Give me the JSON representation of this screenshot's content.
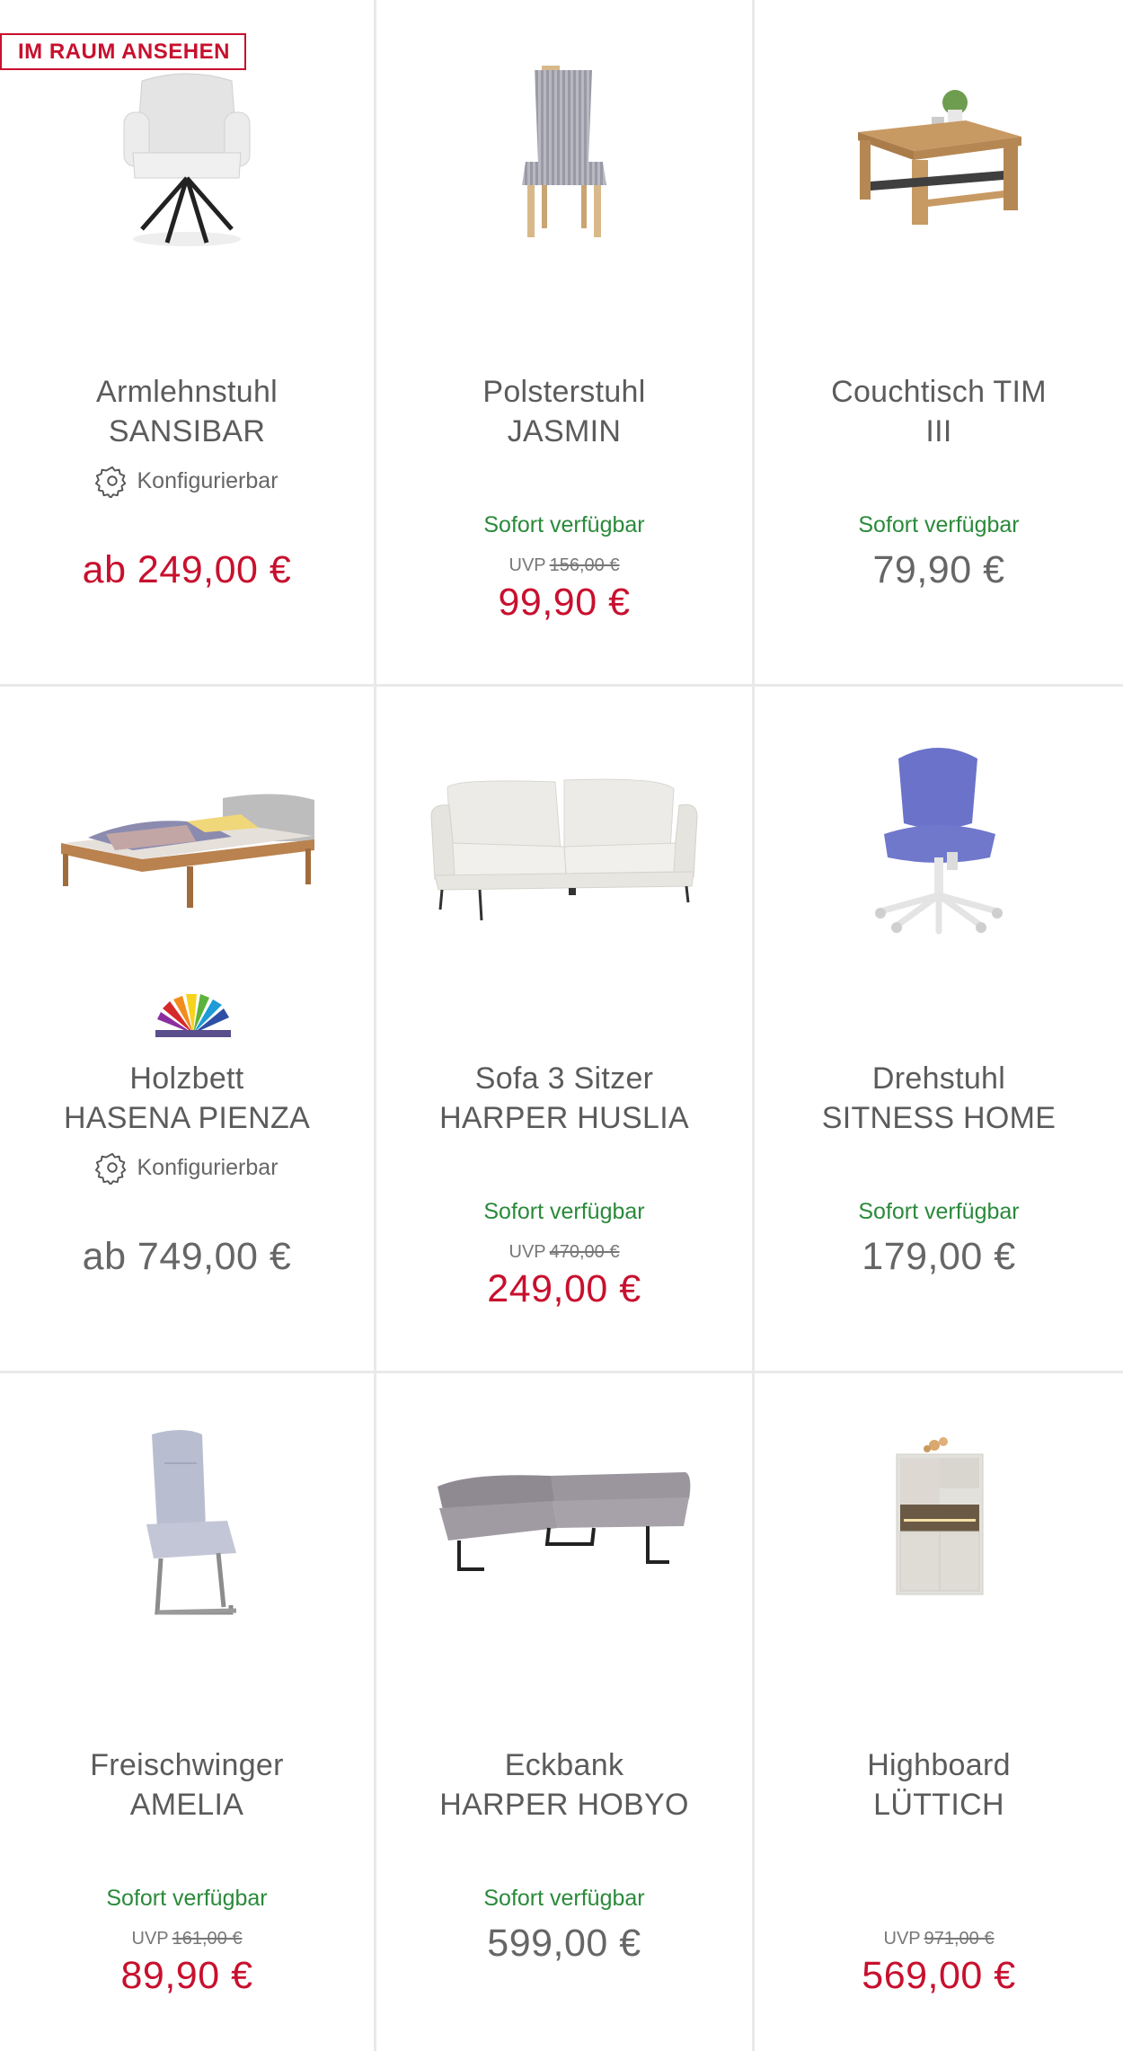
{
  "badge": "IM RAUM ANSEHEN",
  "configurable_label": "Konfigurierbar",
  "products": [
    {
      "line1": "Armlehnstuhl",
      "line2": "SANSIBAR",
      "configurable": true,
      "availability": "",
      "uvp_label": "",
      "uvp_price": "",
      "price": "ab 249,00 €",
      "image": "armchair-grey-black-legs"
    },
    {
      "line1": "Polsterstuhl",
      "line2": "JASMIN",
      "configurable": false,
      "availability": "Sofort verfügbar",
      "uvp_label": "UVP",
      "uvp_price": "156,00 €",
      "price": "99,90 €",
      "image": "upholstered-chair-striped"
    },
    {
      "line1": "Couchtisch TIM",
      "line2": "III",
      "configurable": false,
      "availability": "Sofort verfügbar",
      "uvp_label": "",
      "uvp_price": "",
      "price": "79,90 €",
      "image": "coffee-table-oak"
    },
    {
      "line1": "Holzbett",
      "line2": "HASENA PIENZA",
      "configurable": true,
      "availability": "",
      "uvp_label": "",
      "uvp_price": "",
      "price": "ab 749,00 €",
      "image": "wooden-bed"
    },
    {
      "line1": "Sofa 3 Sitzer",
      "line2": "HARPER HUSLIA",
      "configurable": false,
      "availability": "Sofort verfügbar",
      "uvp_label": "UVP",
      "uvp_price": "470,00 €",
      "price": "249,00 €",
      "image": "sofa-cream"
    },
    {
      "line1": "Drehstuhl",
      "line2": "SITNESS HOME",
      "configurable": false,
      "availability": "Sofort verfügbar",
      "uvp_label": "",
      "uvp_price": "",
      "price": "179,00 €",
      "image": "swivel-chair-blue"
    },
    {
      "line1": "Freischwinger",
      "line2": "AMELIA",
      "configurable": false,
      "availability": "Sofort verfügbar",
      "uvp_label": "UVP",
      "uvp_price": "161,00 €",
      "price": "89,90 €",
      "image": "cantilever-chair-grey"
    },
    {
      "line1": "Eckbank",
      "line2": "HARPER HOBYO",
      "configurable": false,
      "availability": "Sofort verfügbar",
      "uvp_label": "",
      "uvp_price": "",
      "price": "599,00 €",
      "image": "corner-bench-grey"
    },
    {
      "line1": "Highboard",
      "line2": "LÜTTICH",
      "configurable": false,
      "availability": "",
      "uvp_label": "UVP",
      "uvp_price": "971,00 €",
      "price": "569,00 €",
      "image": "highboard-white"
    }
  ],
  "colors": {
    "sale_red": "#c8102e",
    "available_green": "#2a8a3a",
    "text_grey": "#5b5b5b",
    "divider": "#e9e9e9"
  }
}
